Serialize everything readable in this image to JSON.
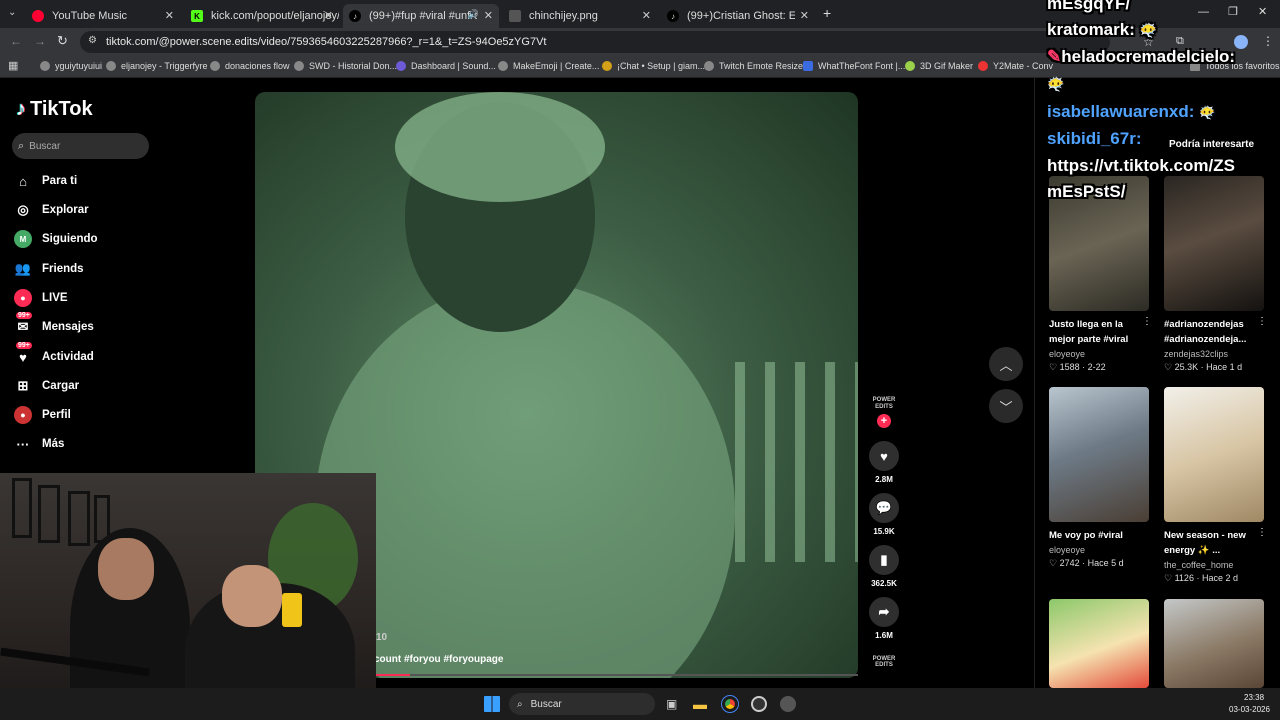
{
  "browser": {
    "tabs": [
      {
        "label": "YouTube Music"
      },
      {
        "label": "kick.com/popout/eljanojey/cha"
      },
      {
        "label": "(99+)#fup #viral #unfreeze"
      },
      {
        "label": "chinchijey.png"
      },
      {
        "label": "(99+)Cristian Ghost: El Fenóme"
      }
    ],
    "url": "tiktok.com/@power.scene.edits/video/7593654603225287966?_r=1&_t=ZS-94Oe5zYG7Vt",
    "bookmarks": [
      "yguiytuyuiui",
      "eljanojey - Triggerfyre",
      "donaciones flow",
      "SWD - Historial Don...",
      "Dashboard | Sound...",
      "MakeEmoji | Create...",
      "¡Chat • Setup | giam...",
      "Twitch Emote Resizer",
      "WhatTheFont Font |...",
      "3D Gif Maker",
      "Y2Mate - Conv"
    ],
    "all_bookmarks": "Todos los favoritos"
  },
  "tiktok": {
    "brand": "TikTok",
    "search_placeholder": "Buscar",
    "nav": [
      {
        "label": "Para ti"
      },
      {
        "label": "Explorar"
      },
      {
        "label": "Siguiendo"
      },
      {
        "label": "Friends"
      },
      {
        "label": "LIVE"
      },
      {
        "label": "Mensajes",
        "badge": "99+"
      },
      {
        "label": "Actividad",
        "badge": "99+"
      },
      {
        "label": "Cargar"
      },
      {
        "label": "Perfil"
      },
      {
        "label": "Más"
      }
    ],
    "video": {
      "caption": "count #foryou #foryoupage",
      "timestamp": "10",
      "progress": 0.07,
      "channel_badge": "POWER EDITS",
      "likes": "2.8M",
      "comments": "15.9K",
      "saves": "362.5K",
      "shares": "1.6M"
    },
    "suggest_title": "Podría interesarte",
    "cards": [
      {
        "title": "Justo llega en la mejor parte #viral",
        "user": "eloyeoye",
        "likes": "1588",
        "date": "2-22"
      },
      {
        "title": "#adrianozendejas #adrianozendeja...",
        "user": "zendejas32clips",
        "likes": "25.3K",
        "date": "Hace 1 d"
      },
      {
        "title": "Me voy po #viral",
        "user": "eloyeoye",
        "likes": "2742",
        "date": "Hace 5 d"
      },
      {
        "title": "New season - new energy ✨ ...",
        "user": "the_coffee_home",
        "likes": "1126",
        "date": "Hace 2 d"
      }
    ]
  },
  "chat": {
    "lines": [
      "mEsgqYF/",
      "kratomark:",
      "heladocremadelcielo:",
      "isabellawuarenxd:",
      "skibidi_67r:",
      "https://vt.tiktok.com/ZS",
      "mEsPstS/"
    ]
  },
  "taskbar": {
    "search": "Buscar",
    "time": "23:38",
    "date": "03-03-2026"
  },
  "colors": {
    "accent": "#fe2c55",
    "link_blue": "#4fa3ff"
  }
}
